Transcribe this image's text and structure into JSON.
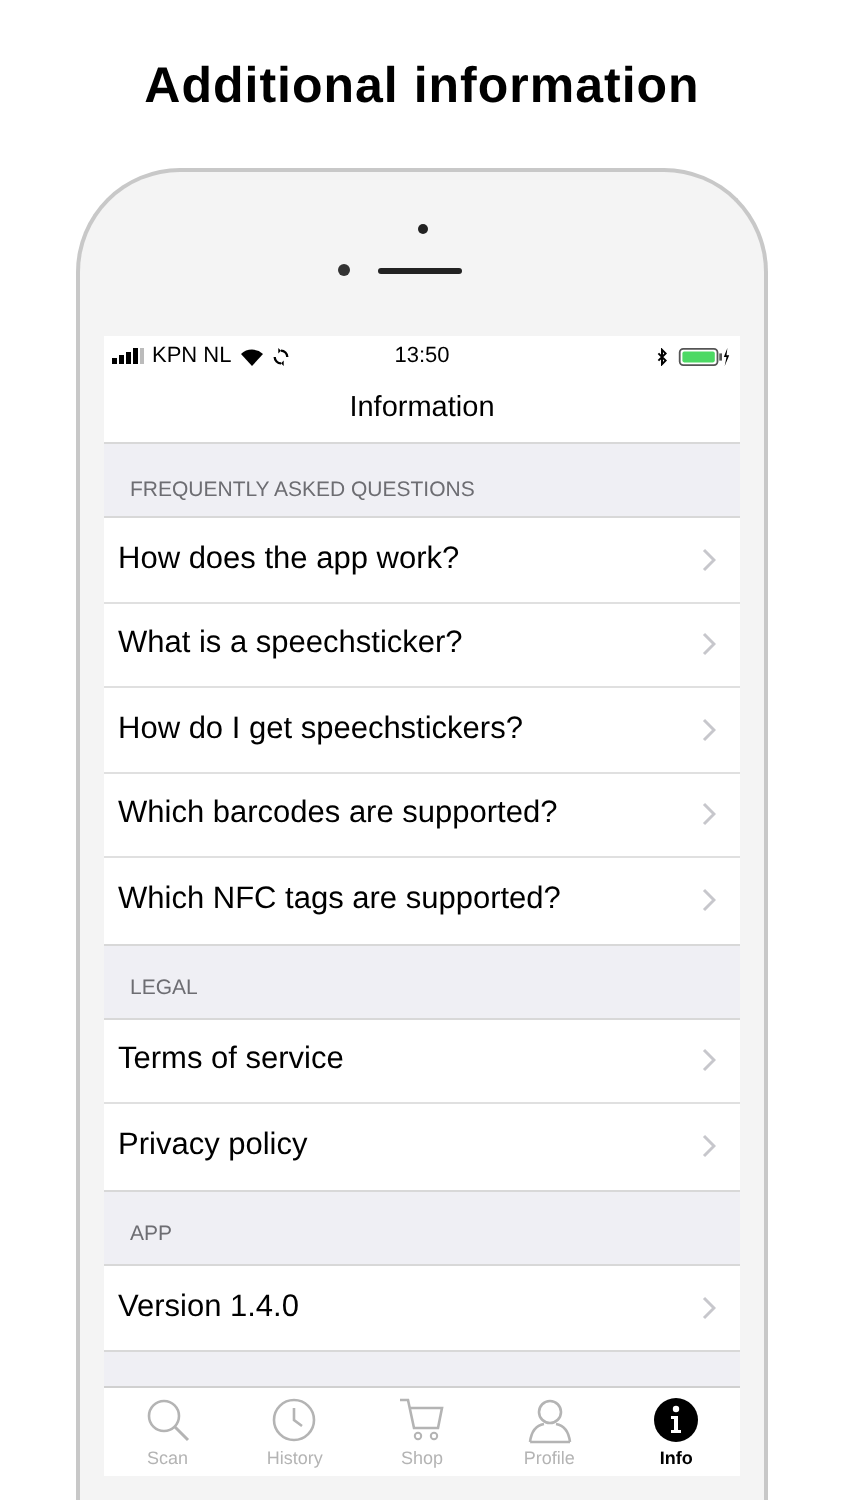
{
  "headline": "Additional information",
  "status_bar": {
    "carrier": "KPN NL",
    "time": "13:50"
  },
  "nav_title": "Information",
  "sections": [
    {
      "header": "FREQUENTLY ASKED QUESTIONS",
      "rows": [
        "How does the app work?",
        "What is a speechsticker?",
        "How do I get speechstickers?",
        "Which barcodes are supported?",
        "Which NFC tags are supported?"
      ]
    },
    {
      "header": "LEGAL",
      "rows": [
        "Terms of service",
        "Privacy policy"
      ]
    },
    {
      "header": "APP",
      "rows": [
        "Version 1.4.0"
      ]
    }
  ],
  "tab_bar": [
    {
      "label": "Scan",
      "selected": false
    },
    {
      "label": "History",
      "selected": false
    },
    {
      "label": "Shop",
      "selected": false
    },
    {
      "label": "Profile",
      "selected": false
    },
    {
      "label": "Info",
      "selected": true
    }
  ]
}
